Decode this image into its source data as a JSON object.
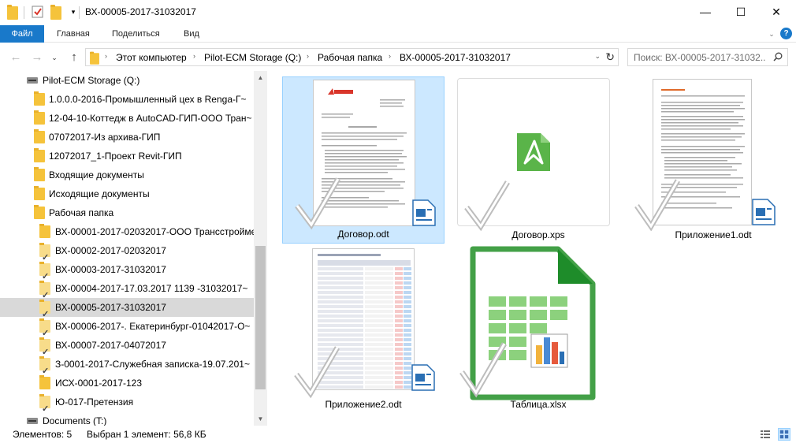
{
  "window": {
    "title": "ВХ-00005-2017-31032017",
    "minimize": "—",
    "maximize": "☐",
    "close": "✕"
  },
  "ribbon": {
    "tabs": [
      "Файл",
      "Главная",
      "Поделиться",
      "Вид"
    ],
    "help": "?"
  },
  "address": {
    "crumbs": [
      "Этот компьютер",
      "Pilot-ECM Storage (Q:)",
      "Рабочая папка",
      "ВХ-00005-2017-31032017"
    ]
  },
  "search": {
    "placeholder": "Поиск: ВХ-00005-2017-31032..."
  },
  "nav": {
    "items": [
      {
        "label": "Pilot-ECM Storage (Q:)",
        "kind": "drive"
      },
      {
        "label": "1.0.0.0-2016-Промышленный цех в Renga-Г~",
        "kind": "folder"
      },
      {
        "label": "12-04-10-Коттедж в AutoCAD-ГИП-ООО Тран~",
        "kind": "folder"
      },
      {
        "label": "07072017-Из архива-ГИП",
        "kind": "folder"
      },
      {
        "label": "12072017_1-Проект Revit-ГИП",
        "kind": "folder"
      },
      {
        "label": "Входящие документы",
        "kind": "folder"
      },
      {
        "label": "Исходящие документы",
        "kind": "folder"
      },
      {
        "label": "Рабочая папка",
        "kind": "folder"
      },
      {
        "label": "ВХ-00001-2017-02032017-ООО Трансстройме~",
        "kind": "subfolder"
      },
      {
        "label": "ВХ-00002-2017-02032017",
        "kind": "subfolder-check"
      },
      {
        "label": "ВХ-00003-2017-31032017",
        "kind": "subfolder-check"
      },
      {
        "label": "ВХ-00004-2017-17.03.2017 1139 -31032017~",
        "kind": "subfolder-check"
      },
      {
        "label": "ВХ-00005-2017-31032017",
        "kind": "subfolder-check",
        "selected": true
      },
      {
        "label": "ВХ-00006-2017-. Екатеринбург-01042017-О~",
        "kind": "subfolder-check"
      },
      {
        "label": "ВХ-00007-2017-04072017",
        "kind": "subfolder-check"
      },
      {
        "label": "З-0001-2017-Служебная записка-19.07.201~",
        "kind": "subfolder-check"
      },
      {
        "label": "ИСХ-0001-2017-123",
        "kind": "subfolder"
      },
      {
        "label": "Ю-017-Претензия",
        "kind": "subfolder-check"
      },
      {
        "label": "Documents (T:)",
        "kind": "drive"
      }
    ]
  },
  "files": [
    {
      "name": "Договор.odt",
      "type": "odt-doc",
      "selected": true
    },
    {
      "name": "Договор.xps",
      "type": "xps"
    },
    {
      "name": "Приложение1.odt",
      "type": "odt-text"
    },
    {
      "name": "Приложение2.odt",
      "type": "odt-table"
    },
    {
      "name": "Таблица.xlsx",
      "type": "xlsx"
    }
  ],
  "status": {
    "count": "Элементов: 5",
    "selected": "Выбран 1 элемент: 56,8 КБ"
  },
  "colors": {
    "accent": "#1979ca",
    "folder": "#f5c33b",
    "selected_tile": "#cce8ff",
    "xps_green": "#5ab449",
    "calc_green": "#43a047"
  }
}
